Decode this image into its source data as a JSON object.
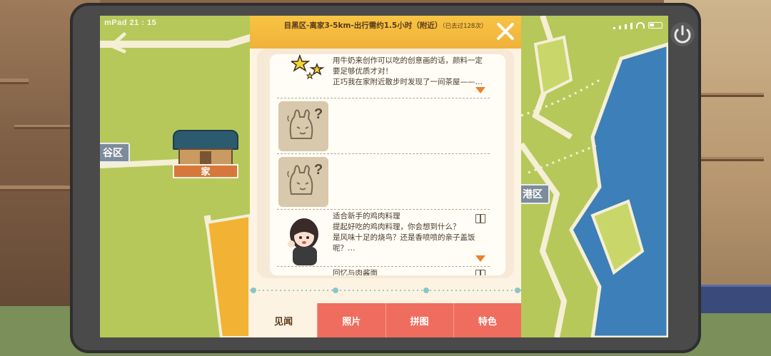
{
  "device": {
    "status_left": "mPad 21 : 15"
  },
  "map": {
    "area_left_label": "谷区",
    "area_right_label": "港区",
    "home_label": "家",
    "colors": {
      "grass": "#b6c85a",
      "road": "#f5efd6",
      "water": "#3d7fb8",
      "plaza": "#f2b233"
    }
  },
  "panel": {
    "header_main": "目黑区-离家3-5km-出行需约1.5小时（附近）",
    "header_sub": "（已去过128次）",
    "entries": [
      {
        "type": "text",
        "image": "stars",
        "lines": [
          "用牛奶来创作可以吃的创意画的话，颜料一定",
          "要足够优质才对！",
          "正巧我在家附近散步时发现了一间茶屋——…"
        ],
        "indicator": "arrow-down"
      },
      {
        "type": "locked",
        "image": "rabbit-question"
      },
      {
        "type": "locked",
        "image": "rabbit-question"
      },
      {
        "type": "text",
        "image": "girl-portrait",
        "lines": [
          "适合新手的鸡肉料理",
          "提起好吃的鸡肉料理，你会想到什么？",
          "是风味十足的烧鸟？还是香喷喷的亲子盖饭",
          "呢？…"
        ],
        "indicator": "book-icon",
        "indicator_bottom": "arrow-down"
      },
      {
        "type": "text",
        "lines": [
          "回忆与肉酱面"
        ],
        "indicator": "book-icon"
      }
    ],
    "tabs": [
      {
        "label": "见闻",
        "active": true
      },
      {
        "label": "照片",
        "active": false
      },
      {
        "label": "拼图",
        "active": false
      },
      {
        "label": "特色",
        "active": false
      }
    ]
  },
  "colors": {
    "header": "#f8c443",
    "tab_inactive": "#ef6d5e",
    "panel_bg": "#fdf3e2",
    "accent_arrow": "#e8822b"
  }
}
